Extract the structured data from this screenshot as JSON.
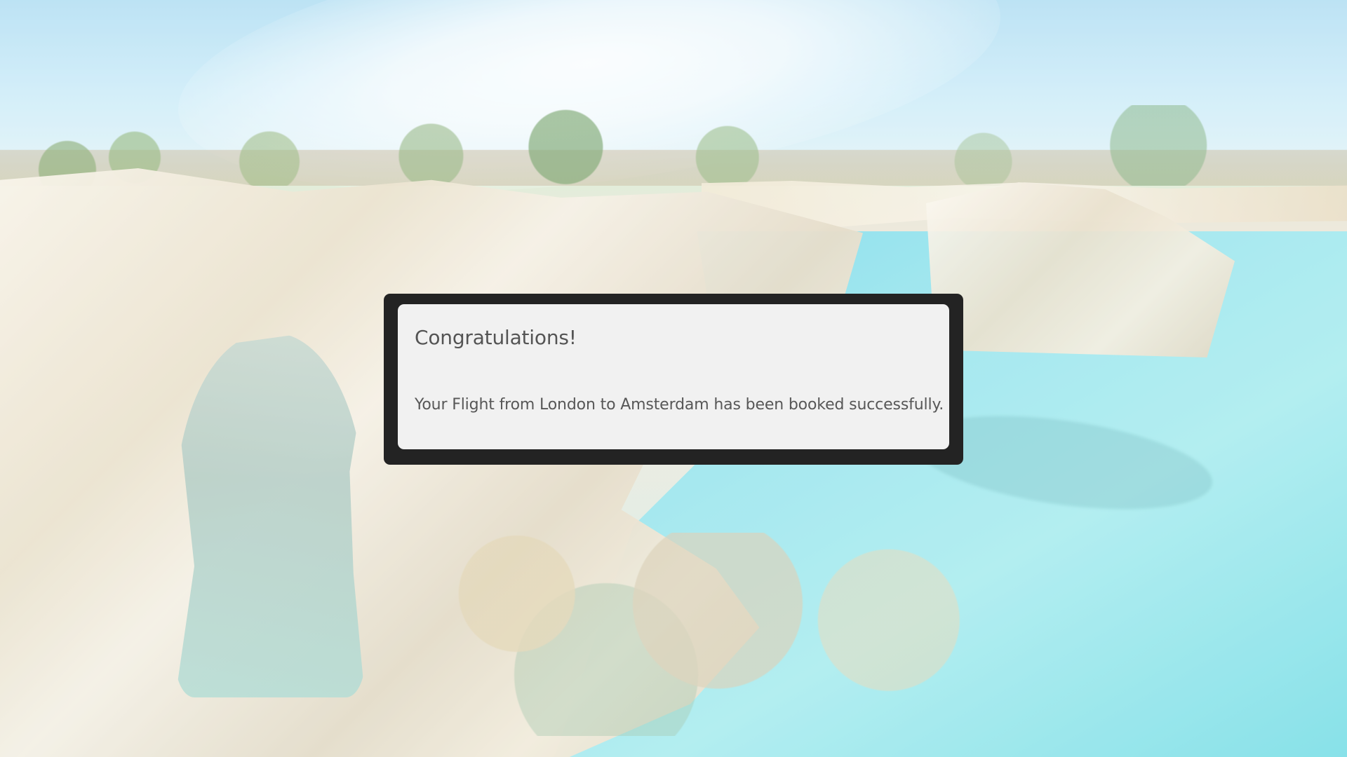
{
  "modal": {
    "title": "Congratulations!",
    "message": "Your Flight from London to Amsterdam has been booked successfully."
  },
  "colors": {
    "modal_border": "#232323",
    "modal_surface": "#f1f1f1",
    "text": "#555555"
  }
}
